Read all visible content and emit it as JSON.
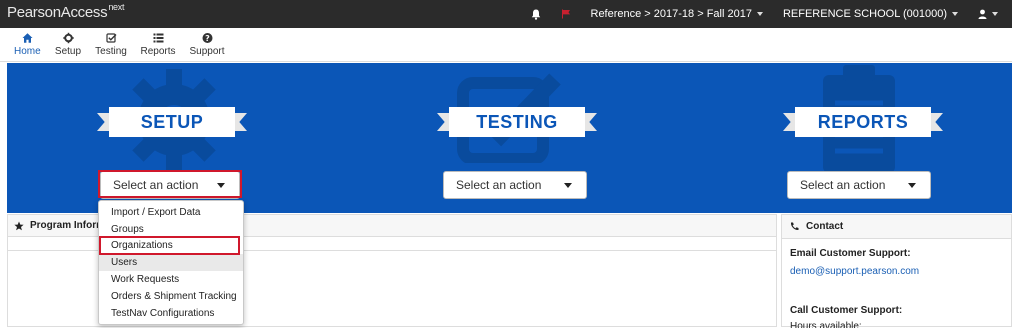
{
  "topbar": {
    "brand": "PearsonAccess",
    "brand_sup": "next",
    "context": "Reference > 2017-18 > Fall 2017",
    "organization": "REFERENCE SCHOOL (001000)",
    "icons": [
      "bell-icon",
      "flag-icon",
      "user-icon"
    ]
  },
  "nav": {
    "items": [
      {
        "label": "Home",
        "icon": "home-icon"
      },
      {
        "label": "Setup",
        "icon": "gear-icon"
      },
      {
        "label": "Testing",
        "icon": "checkbox-icon"
      },
      {
        "label": "Reports",
        "icon": "list-icon"
      },
      {
        "label": "Support",
        "icon": "help-icon"
      }
    ]
  },
  "banner": {
    "setup": {
      "title": "SETUP",
      "select": "Select an action"
    },
    "testing": {
      "title": "TESTING",
      "select": "Select an action"
    },
    "reports": {
      "title": "REPORTS",
      "select": "Select an action"
    }
  },
  "menu": {
    "items": [
      "Import / Export Data",
      "Groups",
      "Organizations",
      "Users",
      "Work Requests",
      "Orders & Shipment Tracking",
      "TestNav Configurations"
    ],
    "highlighted": "Organizations",
    "hovered": "Users"
  },
  "program_panel": {
    "title": "Program Information"
  },
  "contact": {
    "title": "Contact",
    "email_label": "Email Customer Support:",
    "email": "demo@support.pearson.com",
    "call_label": "Call Customer Support:",
    "hours_label": "Hours available:"
  },
  "colors": {
    "banner": "#0b56b7",
    "highlight": "#d0182c",
    "link": "#1a5fb4"
  }
}
